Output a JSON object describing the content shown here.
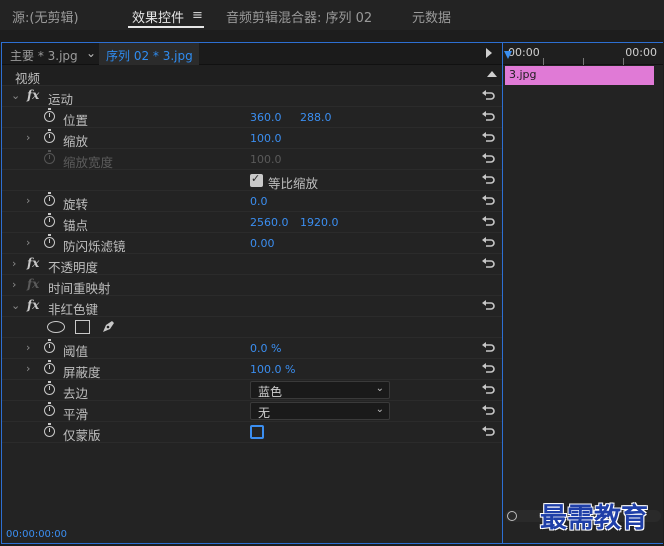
{
  "tabs": [
    {
      "label": "源:(无剪辑)"
    },
    {
      "label": "效果控件"
    },
    {
      "label": "音频剪辑混合器: 序列 02"
    },
    {
      "label": "元数据"
    }
  ],
  "tab_menu_glyph": "≡",
  "clip_header": {
    "master": "主要 * 3.jpg",
    "sequence": "序列 02 * 3.jpg"
  },
  "section_video": "视频",
  "effects": {
    "motion": {
      "label": "运动",
      "position": {
        "label": "位置",
        "x": "360.0",
        "y": "288.0"
      },
      "scale": {
        "label": "缩放",
        "value": "100.0"
      },
      "scale_width": {
        "label": "缩放宽度",
        "value": "100.0"
      },
      "uniform_scale": {
        "label": "等比缩放",
        "checked": true
      },
      "rotation": {
        "label": "旋转",
        "value": "0.0"
      },
      "anchor": {
        "label": "锚点",
        "x": "2560.0",
        "y": "1920.0"
      },
      "flicker": {
        "label": "防闪烁滤镜",
        "value": "0.00"
      }
    },
    "opacity": {
      "label": "不透明度"
    },
    "time_remap": {
      "label": "时间重映射"
    },
    "nonred_key": {
      "label": "非红色键",
      "threshold": {
        "label": "阈值",
        "value": "0.0 %"
      },
      "cutoff": {
        "label": "屏蔽度",
        "value": "100.0 %"
      },
      "defringe": {
        "label": "去边",
        "value": "蓝色"
      },
      "smoothing": {
        "label": "平滑",
        "value": "无"
      },
      "mask_only": {
        "label": "仅蒙版",
        "checked": false
      }
    }
  },
  "timeline": {
    "start": "00:00",
    "end": "00:00",
    "clip_name": "3.jpg"
  },
  "current_time": "00:00:00:00",
  "watermark": "最需教育",
  "colors": {
    "accent": "#2f8cf0",
    "clip": "#e07ad6",
    "panel_border": "#2d6fd2"
  }
}
